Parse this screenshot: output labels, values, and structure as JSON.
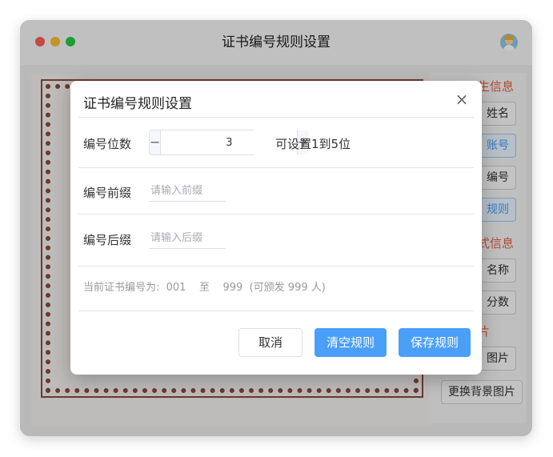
{
  "window": {
    "title": "证书编号规则设置"
  },
  "sidebar": {
    "section1_heading": "生信息",
    "section2_heading": "式信息",
    "section3_heading": "片",
    "items": [
      {
        "label": "姓名"
      },
      {
        "label": "账号"
      },
      {
        "label": "编号"
      },
      {
        "label": "规则"
      },
      {
        "label": "名称"
      },
      {
        "label": "分数"
      },
      {
        "label": "图片"
      },
      {
        "label": "更换背景图片"
      }
    ]
  },
  "dialog": {
    "title": "证书编号规则设置",
    "digits_label": "编号位数",
    "digits_value": "3",
    "digits_hint": "可设置1到5位",
    "prefix_label": "编号前缀",
    "prefix_placeholder": "请输入前缀",
    "suffix_label": "编号后缀",
    "suffix_placeholder": "请输入后缀",
    "summary": "当前证书编号为:  001    至    999  (可颁发 999 人)",
    "cancel_label": "取消",
    "clear_label": "清空规则",
    "save_label": "保存规则"
  },
  "colors": {
    "accent": "#4a9ff9",
    "sidebar_heading": "#e0603f",
    "certificate_border": "#8a4a3c"
  }
}
